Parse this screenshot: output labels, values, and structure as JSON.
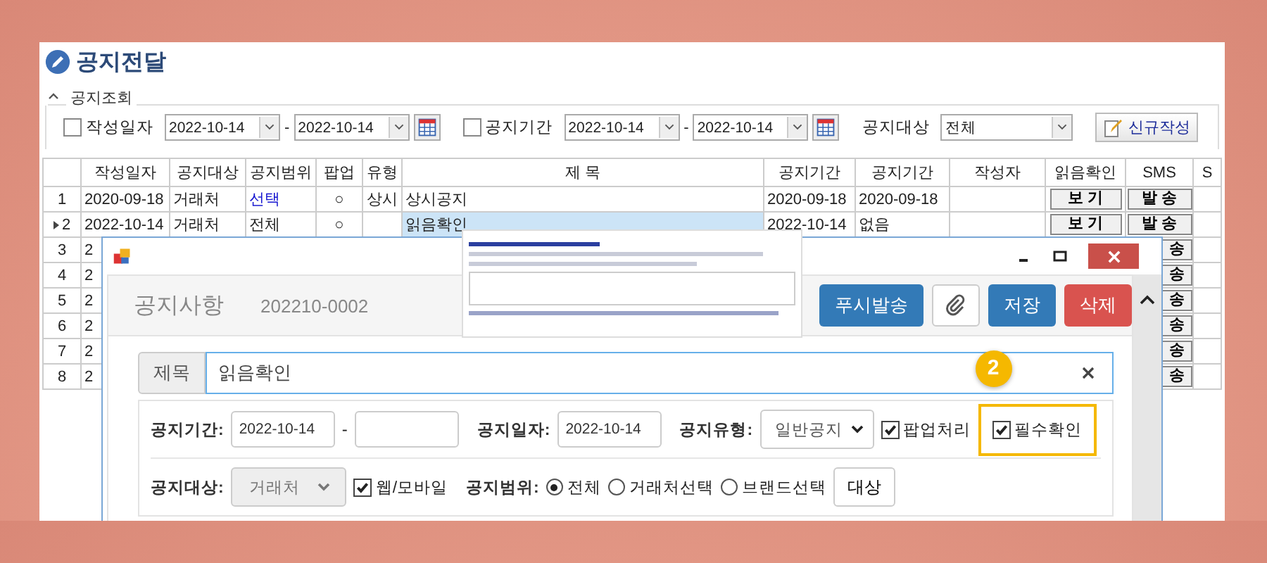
{
  "page_title": "공지전달",
  "search_panel": {
    "legend": "공지조회",
    "filters": [
      {
        "kind": "date-range",
        "label": "작성일자",
        "checked": false,
        "from": "2022-10-14",
        "separator": "-",
        "to": "2022-10-14"
      },
      {
        "kind": "date-range",
        "label": "공지기간",
        "checked": false,
        "from": "2022-10-14",
        "separator": "-",
        "to": "2022-10-14"
      },
      {
        "kind": "select",
        "label": "공지대상",
        "value": "전체"
      }
    ],
    "new_button": "신규작성"
  },
  "table": {
    "columns": [
      "작성일자",
      "공지대상",
      "공지범위",
      "팝업",
      "유형",
      "제 목",
      "공지기간",
      "공지기간",
      "작성자",
      "읽음확인",
      "SMS",
      "S"
    ],
    "rows": [
      {
        "number": "1",
        "selected": false,
        "written": "2020-09-18",
        "target": "거래처",
        "scope": "선택",
        "scope_link": true,
        "popup": "○",
        "type": "상시",
        "title": "상시공지",
        "period_from": "2020-09-18",
        "period_to": "2020-09-18",
        "read_button": "보 기",
        "sms_button": "발 송"
      },
      {
        "number": "2",
        "selected": true,
        "written": "2022-10-14",
        "target": "거래처",
        "scope": "전체",
        "scope_link": false,
        "popup": "○",
        "title": "읽음확인",
        "period_from": "2022-10-14",
        "period_to": "없음",
        "read_button": "보 기",
        "sms_button": "발 송"
      },
      {
        "number": "3",
        "selected": false,
        "written": "2",
        "sms_button": "송"
      },
      {
        "number": "4",
        "selected": false,
        "written": "2",
        "sms_button": "송"
      },
      {
        "number": "5",
        "selected": false,
        "written": "2",
        "sms_button": "송"
      },
      {
        "number": "6",
        "selected": false,
        "written": "2",
        "sms_button": "송"
      },
      {
        "number": "7",
        "selected": false,
        "written": "2",
        "sms_button": "송"
      },
      {
        "number": "8",
        "selected": false,
        "written": "2",
        "sms_button": "송"
      }
    ]
  },
  "dialog": {
    "title": "공지사항",
    "number": "202210-0002",
    "buttons": [
      {
        "kind": "primary",
        "label": "푸시발송"
      },
      {
        "kind": "attach"
      },
      {
        "kind": "primary",
        "label": "저장"
      },
      {
        "kind": "danger",
        "label": "삭제"
      }
    ],
    "subject": {
      "label": "제목",
      "value": "읽음확인"
    },
    "form_rows": [
      [
        {
          "kind": "label",
          "text": "공지기간:"
        },
        {
          "kind": "input",
          "value": "2022-10-14"
        },
        {
          "kind": "separator",
          "text": "-"
        },
        {
          "kind": "input"
        },
        {
          "kind": "label",
          "text": "공지일자:"
        },
        {
          "kind": "input",
          "value": "2022-10-14"
        },
        {
          "kind": "label",
          "text": "공지유형:"
        },
        {
          "kind": "select",
          "value": "일반공지",
          "disabled": false
        },
        {
          "kind": "checkbox",
          "label": "팝업처리",
          "checked": true
        },
        {
          "kind": "checkbox",
          "label": "필수확인",
          "checked": true,
          "callout": "2"
        }
      ],
      [
        {
          "kind": "label",
          "text": "공지대상:"
        },
        {
          "kind": "select",
          "value": "거래처",
          "disabled": true
        },
        {
          "kind": "checkbox",
          "label": "웹/모바일",
          "checked": true
        },
        {
          "kind": "label",
          "text": "공지범위:"
        },
        {
          "kind": "radio",
          "label": "전체",
          "selected": true
        },
        {
          "kind": "radio",
          "label": "거래처선택",
          "selected": false
        },
        {
          "kind": "radio",
          "label": "브랜드선택",
          "selected": false
        },
        {
          "kind": "button",
          "label": "대상"
        }
      ]
    ]
  }
}
